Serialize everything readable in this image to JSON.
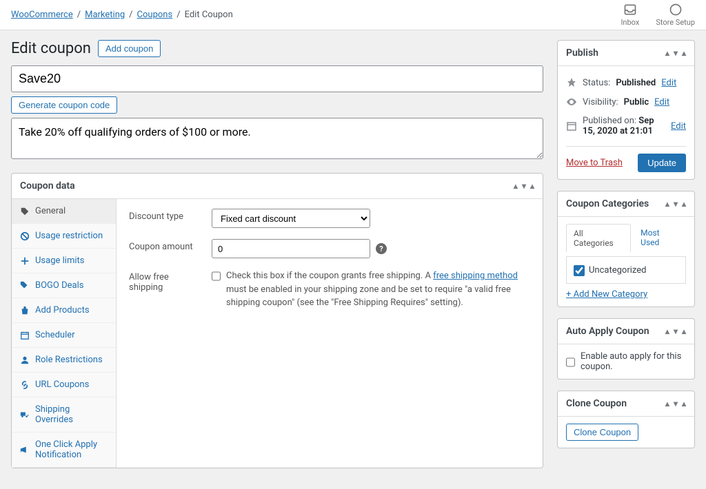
{
  "breadcrumb": {
    "woocommerce": "WooCommerce",
    "marketing": "Marketing",
    "coupons": "Coupons",
    "current": "Edit Coupon"
  },
  "topbar": {
    "inbox": "Inbox",
    "store_setup": "Store Setup"
  },
  "header": {
    "title": "Edit coupon",
    "add_coupon": "Add coupon"
  },
  "coupon": {
    "code": "Save20",
    "generate_btn": "Generate coupon code",
    "description": "Take 20% off qualifying orders of $100 or more."
  },
  "coupon_data": {
    "title": "Coupon data",
    "tabs": {
      "general": "General",
      "usage_restriction": "Usage restriction",
      "usage_limits": "Usage limits",
      "bogo": "BOGO Deals",
      "add_products": "Add Products",
      "scheduler": "Scheduler",
      "role_restrictions": "Role Restrictions",
      "url_coupons": "URL Coupons",
      "shipping_overrides": "Shipping Overrides",
      "one_click": "One Click Apply Notification"
    },
    "general": {
      "discount_type_label": "Discount type",
      "discount_type_value": "Fixed cart discount",
      "coupon_amount_label": "Coupon amount",
      "coupon_amount_value": "0",
      "free_shipping_label": "Allow free shipping",
      "free_shipping_desc_1": "Check this box if the coupon grants free shipping. A ",
      "free_shipping_link": "free shipping method",
      "free_shipping_desc_2": " must be enabled in your shipping zone and be set to require \"a valid free shipping coupon\" (see the \"Free Shipping Requires\" setting)."
    }
  },
  "publish": {
    "title": "Publish",
    "status_label": "Status:",
    "status_value": "Published",
    "visibility_label": "Visibility:",
    "visibility_value": "Public",
    "published_label": "Published on:",
    "published_value": "Sep 15, 2020 at 21:01",
    "edit": "Edit",
    "move_to_trash": "Move to Trash",
    "update": "Update"
  },
  "categories": {
    "title": "Coupon Categories",
    "tab_all": "All Categories",
    "tab_most": "Most Used",
    "uncategorized": "Uncategorized",
    "add_new": "+ Add New Category"
  },
  "auto_apply": {
    "title": "Auto Apply Coupon",
    "label": "Enable auto apply for this coupon."
  },
  "clone": {
    "title": "Clone Coupon",
    "button": "Clone Coupon"
  }
}
